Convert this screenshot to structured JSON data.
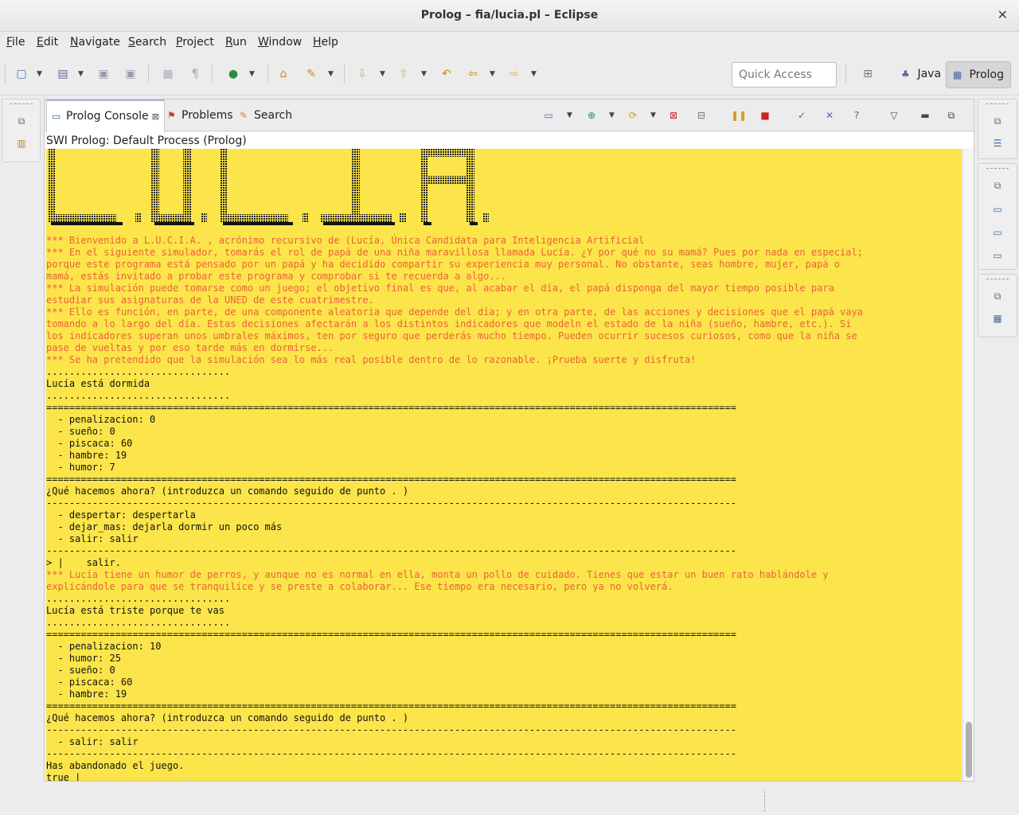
{
  "window": {
    "title": "Prolog – fia/lucia.pl – Eclipse"
  },
  "menu": [
    "File",
    "Edit",
    "Navigate",
    "Search",
    "Project",
    "Run",
    "Window",
    "Help"
  ],
  "quick_access": {
    "placeholder": "Quick Access"
  },
  "perspectives": [
    {
      "label": "Java",
      "icon": "java-perspective-icon",
      "active": false
    },
    {
      "label": "Prolog",
      "icon": "prolog-perspective-icon",
      "active": true
    }
  ],
  "tabs": [
    {
      "label": "Prolog Console",
      "icon": "console-icon",
      "active": true
    },
    {
      "label": "Problems",
      "icon": "problems-icon",
      "active": false
    },
    {
      "label": "Search",
      "icon": "search-icon",
      "active": false
    }
  ],
  "process_label": "SWI Prolog: Default Process (Prolog)",
  "banner_text": "L.U.C.I.A.",
  "colors": {
    "console_bg": "#fbe54a",
    "console_red": "#e8623a",
    "console_text": "#111111"
  },
  "console_lines": [
    {
      "t": "*** Bienvenido a L.U.C.I.A. , acrónimo recursivo de (Lucía, Única Candidata para Inteligencia Artificial",
      "red": true
    },
    {
      "t": "*** En el siguiente simulador, tomarás el rol de papá de una niña maravillosa llamada Lucía. ¿Y por qué no su mamá? Pues por nada en especial;",
      "red": true
    },
    {
      "t": "porque este programa está pensado por un papá y ha decidido compartir su experiencia muy personal. No obstante, seas hombre, mujer, papá o",
      "red": true
    },
    {
      "t": "mamá, estás invitado a probar este programa y comprobar si te recuerda a algo...",
      "red": true
    },
    {
      "t": "*** La simulación puede tomarse como un juego; el objetivo final es que, al acabar el día, el papá disponga del mayor tiempo posible para",
      "red": true
    },
    {
      "t": "estudiar sus asignaturas de la UNED de este cuatrimestre.",
      "red": true
    },
    {
      "t": "*** Ello es función, en parte, de una componente aleatoria que depende del día; y en otra parte, de las acciones y decisiones que el papá vaya",
      "red": true
    },
    {
      "t": "tomando a lo largo del día. Estas decisiones afectarán a los distintos indicadores que modeln el estado de la niña (sueño, hambre, etc.). Si",
      "red": true
    },
    {
      "t": "los indicadores superan unos umbrales máximos, ten por seguro que perderás mucho tiempo. Pueden ocurrir sucesos curiosos, como que la niña se",
      "red": true
    },
    {
      "t": "pase de vueltas y por eso tarde más en dormirse...",
      "red": true
    },
    {
      "t": "*** Se ha pretendido que la simulación sea lo más real posible dentro de lo razonable. ¡Prueba suerte y disfruta!",
      "red": true
    },
    {
      "t": "................................",
      "red": false
    },
    {
      "t": "Lucía está dormida",
      "red": false
    },
    {
      "t": "................................",
      "red": false
    },
    {
      "t": "========================================================================================================================",
      "red": false
    },
    {
      "t": "  - penalizacion: 0",
      "red": false
    },
    {
      "t": "  - sueño: 0",
      "red": false
    },
    {
      "t": "  - piscaca: 60",
      "red": false
    },
    {
      "t": "  - hambre: 19",
      "red": false
    },
    {
      "t": "  - humor: 7",
      "red": false
    },
    {
      "t": "========================================================================================================================",
      "red": false
    },
    {
      "t": "¿Qué hacemos ahora? (introduzca un comando seguido de punto . )",
      "red": false
    },
    {
      "t": "------------------------------------------------------------------------------------------------------------------------",
      "red": false
    },
    {
      "t": "  - despertar: despertarla",
      "red": false
    },
    {
      "t": "  - dejar_mas: dejarla dormir un poco más",
      "red": false
    },
    {
      "t": "  - salir: salir",
      "red": false
    },
    {
      "t": "------------------------------------------------------------------------------------------------------------------------",
      "red": false
    },
    {
      "t": "> |    salir.",
      "red": false
    },
    {
      "t": "*** Lucía tiene un humor de perros, y aunque no es normal en ella, monta un pollo de cuidado. Tienes que estar un buen rato hablándole y",
      "red": true
    },
    {
      "t": "explicándole para que se tranquilice y se preste a colaborar... Ese tiempo era necesario, pero ya no volverá.",
      "red": true
    },
    {
      "t": "................................",
      "red": false
    },
    {
      "t": "Lucía está triste porque te vas",
      "red": false
    },
    {
      "t": "................................",
      "red": false
    },
    {
      "t": "========================================================================================================================",
      "red": false
    },
    {
      "t": "  - penalizacion: 10",
      "red": false
    },
    {
      "t": "  - humor: 25",
      "red": false
    },
    {
      "t": "  - sueño: 0",
      "red": false
    },
    {
      "t": "  - piscaca: 60",
      "red": false
    },
    {
      "t": "  - hambre: 19",
      "red": false
    },
    {
      "t": "========================================================================================================================",
      "red": false
    },
    {
      "t": "¿Qué hacemos ahora? (introduzca un comando seguido de punto . )",
      "red": false
    },
    {
      "t": "------------------------------------------------------------------------------------------------------------------------",
      "red": false
    },
    {
      "t": "  - salir: salir",
      "red": false
    },
    {
      "t": "------------------------------------------------------------------------------------------------------------------------",
      "red": false
    },
    {
      "t": "Has abandonado el juego.",
      "red": false
    },
    {
      "t": "true |",
      "red": false
    }
  ]
}
